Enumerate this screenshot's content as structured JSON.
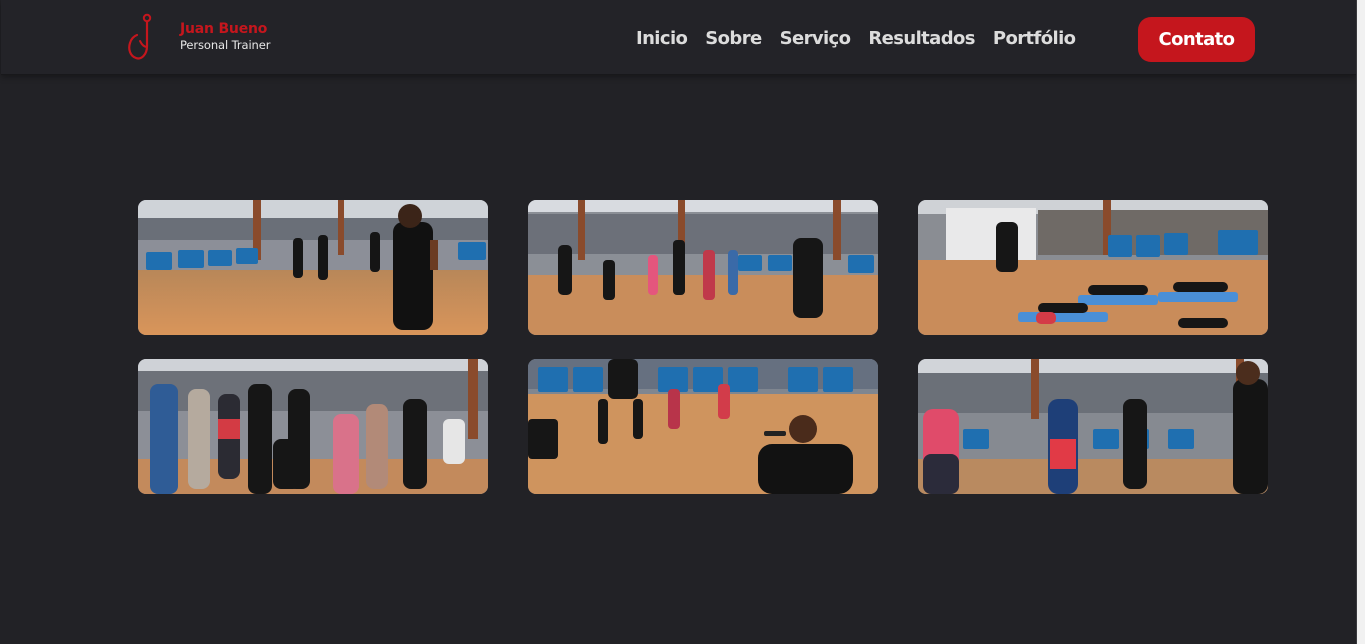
{
  "brand": {
    "name": "Juan Bueno",
    "subtitle": "Personal Trainer",
    "accent_color": "#c5161d"
  },
  "nav": {
    "items": [
      "Inicio",
      "Sobre",
      "Serviço",
      "Resultados",
      "Portfólio"
    ],
    "contact_label": "Contato"
  },
  "gallery": {
    "photos": [
      {
        "icon": "photo-trainer-with-mic-leading-group"
      },
      {
        "icon": "photo-group-dance-class-on-deck"
      },
      {
        "icon": "photo-floor-exercise-on-mats"
      },
      {
        "icon": "photo-group-posing-celebration"
      },
      {
        "icon": "photo-trainer-kneeling-with-mic"
      },
      {
        "icon": "photo-class-dancing-with-instructor"
      }
    ]
  }
}
